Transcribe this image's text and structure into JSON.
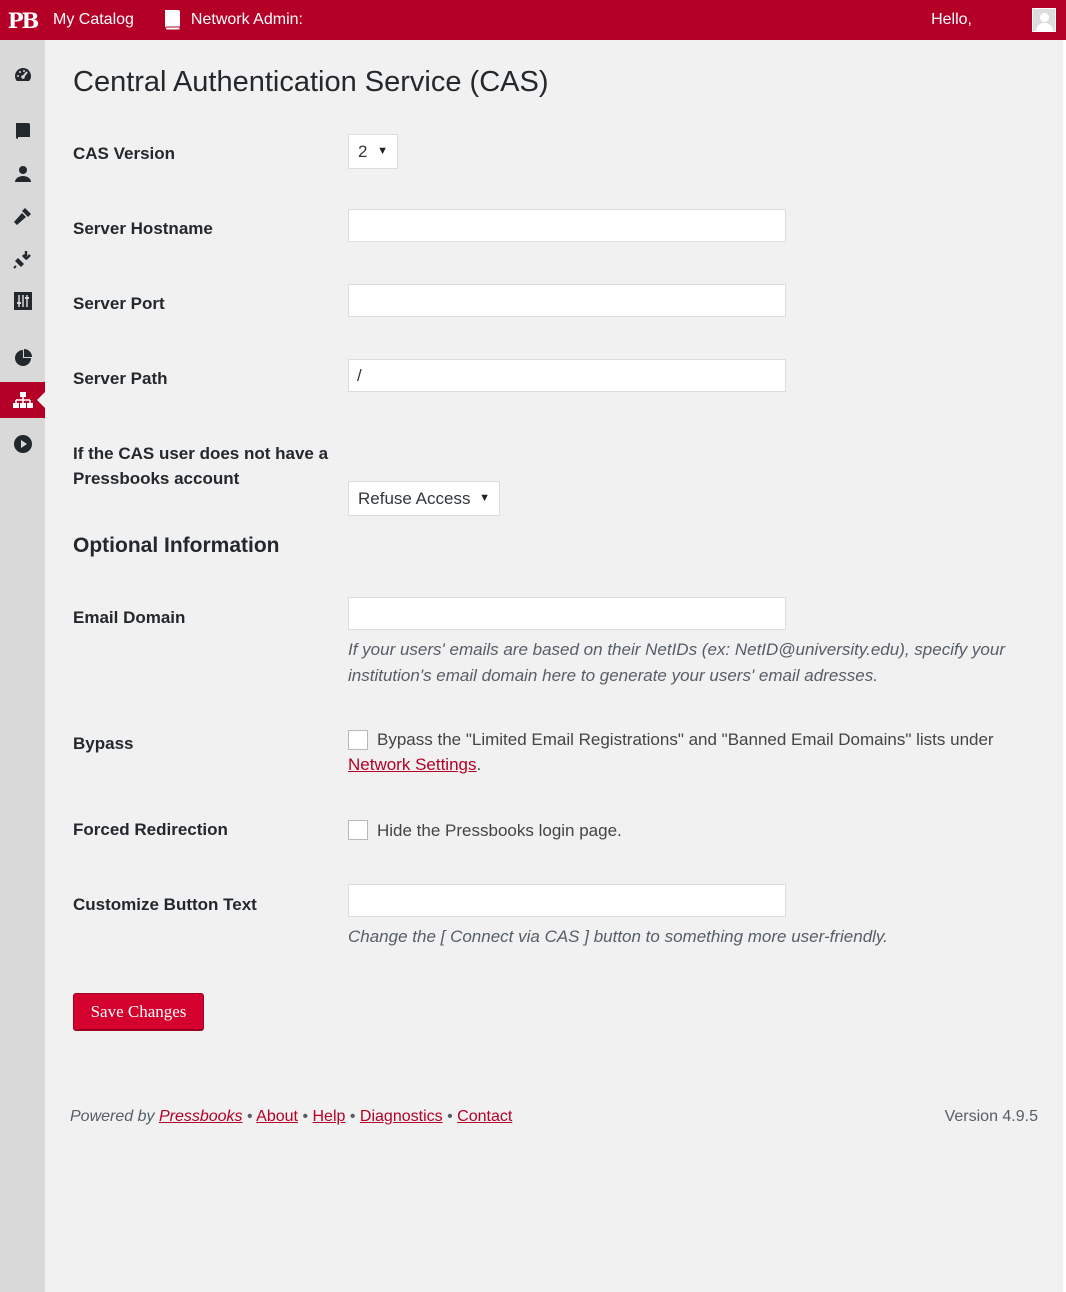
{
  "adminbar": {
    "logo": "PB",
    "my_catalog": "My Catalog",
    "network_admin": "Network Admin:",
    "hello": "Hello,"
  },
  "sidebar": {
    "items": [
      {
        "icon": "dashboard-icon"
      },
      {
        "icon": "books-icon"
      },
      {
        "icon": "users-icon"
      },
      {
        "icon": "themes-icon"
      },
      {
        "icon": "plugins-icon"
      },
      {
        "icon": "settings-icon"
      },
      {
        "icon": "stats-icon"
      },
      {
        "icon": "network-icon",
        "active": true
      },
      {
        "icon": "play-icon"
      }
    ]
  },
  "page": {
    "title": "Central Authentication Service (CAS)"
  },
  "form": {
    "cas_version": {
      "label": "CAS Version",
      "value": "2"
    },
    "server_hostname": {
      "label": "Server Hostname",
      "value": ""
    },
    "server_port": {
      "label": "Server Port",
      "value": ""
    },
    "server_path": {
      "label": "Server Path",
      "value": "/"
    },
    "no_account": {
      "label_line1": "If the CAS user does not have a",
      "label_line2": "Pressbooks account",
      "value": "Refuse Access"
    },
    "optional_title": "Optional Information",
    "email_domain": {
      "label": "Email Domain",
      "value": "",
      "desc_line1": "If your users' emails are based on their NetIDs (ex: NetID@university.edu), specify your",
      "desc_line2": "institution's email domain here to generate your users' email adresses."
    },
    "bypass": {
      "label": "Bypass",
      "text_line1": "Bypass the \"Limited Email Registrations\" and \"Banned Email Domains\" lists under",
      "link": "Network Settings",
      "after_link": ".",
      "checked": false
    },
    "forced_redirection": {
      "label": "Forced Redirection",
      "text": "Hide the Pressbooks login page.",
      "checked": false
    },
    "button_text": {
      "label": "Customize Button Text",
      "value": "",
      "desc": "Change the [ Connect via CAS ] button to something more user-friendly."
    },
    "save_label": "Save Changes"
  },
  "footer": {
    "powered_by": "Powered by",
    "pressbooks": "Pressbooks",
    "about": "About",
    "help": "Help",
    "diagnostics": "Diagnostics",
    "contact": "Contact",
    "sep": "•",
    "version": "Version 4.9.5"
  },
  "colors": {
    "brand": "#b40026",
    "button": "#d4002d",
    "background": "#f1f1f1"
  }
}
